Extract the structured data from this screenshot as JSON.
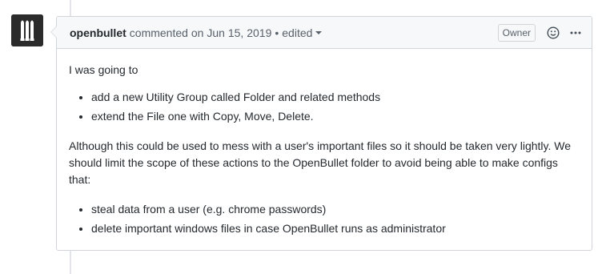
{
  "comment": {
    "author": "openbullet",
    "action": "commented on",
    "date": "Jun 15, 2019",
    "separator": "•",
    "edited_label": "edited",
    "owner_badge": "Owner",
    "body": {
      "intro": "I was going to",
      "list1": [
        "add a new Utility Group called Folder and related methods",
        "extend the File one with Copy, Move, Delete."
      ],
      "paragraph": "Although this could be used to mess with a user's important files so it should be taken very lightly. We should limit the scope of these actions to the OpenBullet folder to avoid being able to make configs that:",
      "list2": [
        "steal data from a user (e.g. chrome passwords)",
        "delete important windows files in case OpenBullet runs as administrator"
      ]
    }
  },
  "icons": {
    "avatar": "openbullet-logo",
    "reaction": "smiley-icon",
    "more": "kebab-horizontal-icon",
    "dropdown": "triangle-down-icon"
  },
  "colors": {
    "header_bg": "#f6f8fa",
    "border": "#d1d5da",
    "text": "#24292e",
    "muted": "#586069",
    "avatar_bg": "#2b2b2b"
  }
}
